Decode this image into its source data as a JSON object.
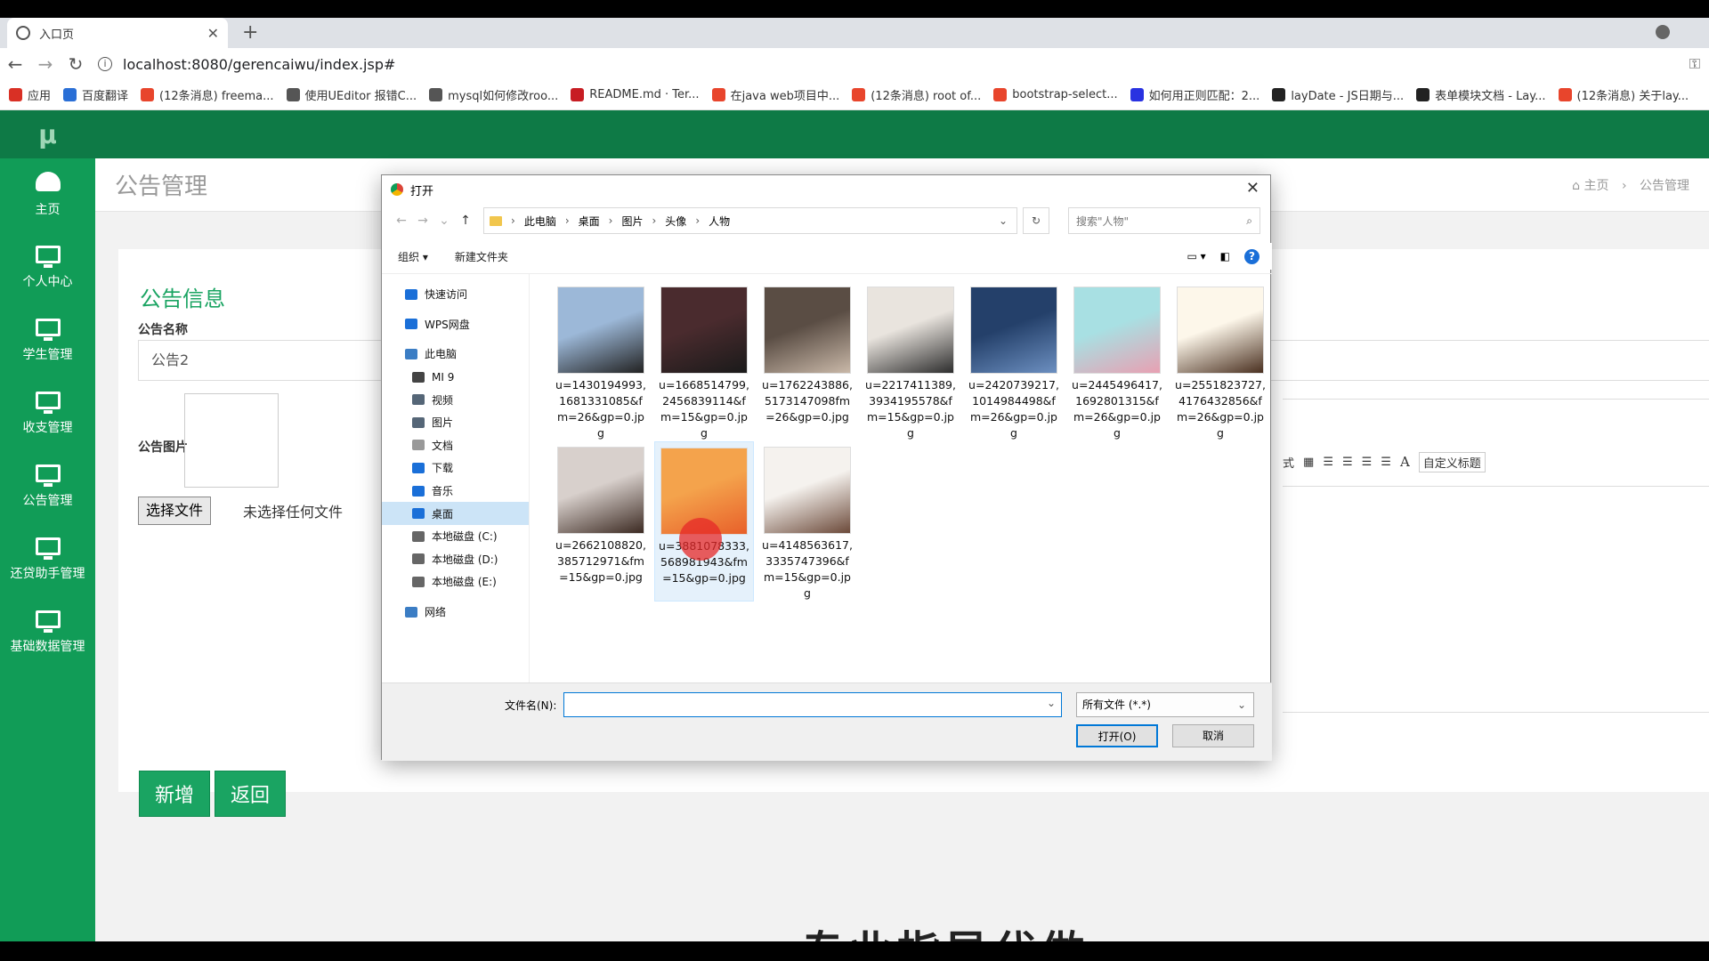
{
  "browser": {
    "tab_title": "入口页",
    "url": "localhost:8080/gerencaiwu/index.jsp#",
    "bookmarks": [
      {
        "label": "应用",
        "color": "#d93025"
      },
      {
        "label": "百度翻译",
        "color": "#2a6fd6"
      },
      {
        "label": "(12条消息) freema...",
        "color": "#e8452c"
      },
      {
        "label": "使用UEditor 报错C...",
        "color": "#555555"
      },
      {
        "label": "mysql如何修改roo...",
        "color": "#555555"
      },
      {
        "label": "README.md · Ter...",
        "color": "#c71d23"
      },
      {
        "label": "在java web项目中...",
        "color": "#e8452c"
      },
      {
        "label": "(12条消息) root of...",
        "color": "#e8452c"
      },
      {
        "label": "bootstrap-select...",
        "color": "#e8452c"
      },
      {
        "label": "如何用正则匹配：2...",
        "color": "#2932e1"
      },
      {
        "label": "layDate - JS日期与...",
        "color": "#222222"
      },
      {
        "label": "表单模块文档 - Lay...",
        "color": "#222222"
      },
      {
        "label": "(12条消息) 关于lay...",
        "color": "#e8452c"
      }
    ]
  },
  "sidebar": {
    "logo": "μ",
    "items": [
      {
        "label": "主页"
      },
      {
        "label": "个人中心"
      },
      {
        "label": "学生管理"
      },
      {
        "label": "收支管理"
      },
      {
        "label": "公告管理"
      },
      {
        "label": "还贷助手管理"
      },
      {
        "label": "基础数据管理"
      }
    ]
  },
  "page": {
    "title": "公告管理",
    "breadcrumb_home": "主页",
    "breadcrumb_current": "公告管理",
    "panel_title": "公告信息",
    "name_label": "公告名称",
    "name_value": "公告2",
    "image_label": "公告图片",
    "file_button": "选择文件",
    "file_status": "未选择任何文件",
    "editor_tools": [
      "式",
      "A",
      "自定义标题"
    ],
    "add_button": "新增",
    "back_button": "返回"
  },
  "dialog": {
    "title": "打开",
    "path": [
      "此电脑",
      "桌面",
      "图片",
      "头像",
      "人物"
    ],
    "search_placeholder": "搜索\"人物\"",
    "organize": "组织 ▾",
    "new_folder": "新建文件夹",
    "help": "?",
    "nav": [
      {
        "label": "快速访问",
        "color": "#1a6fd8"
      },
      {
        "label": "WPS网盘",
        "color": "#1a6fd8"
      },
      {
        "label": "此电脑",
        "color": "#3b7dc4"
      },
      {
        "label": "MI 9",
        "color": "#444444"
      },
      {
        "label": "视频",
        "color": "#556677"
      },
      {
        "label": "图片",
        "color": "#556677"
      },
      {
        "label": "文档",
        "color": "#999999"
      },
      {
        "label": "下载",
        "color": "#1a6fd8"
      },
      {
        "label": "音乐",
        "color": "#1a6fd8"
      },
      {
        "label": "桌面",
        "color": "#1a6fd8"
      },
      {
        "label": "本地磁盘 (C:)",
        "color": "#666666"
      },
      {
        "label": "本地磁盘 (D:)",
        "color": "#666666"
      },
      {
        "label": "本地磁盘 (E:)",
        "color": "#666666"
      },
      {
        "label": "网络",
        "color": "#3b7dc4"
      }
    ],
    "files": [
      {
        "l1": "u=1430194993,",
        "l2": "1681331085&f",
        "l3": "m=26&gp=0.jp",
        "l4": "g",
        "c1": "#9cb8d8",
        "c2": "#222222"
      },
      {
        "l1": "u=1668514799,",
        "l2": "2456839114&f",
        "l3": "m=15&gp=0.jp",
        "l4": "g",
        "c1": "#4a2b2e",
        "c2": "#1a1a1a"
      },
      {
        "l1": "u=1762243886,",
        "l2": "5173147098fm",
        "l3": "=26&gp=0.jpg",
        "l4": "",
        "c1": "#5a4d44",
        "c2": "#c9b8a8"
      },
      {
        "l1": "u=2217411389,",
        "l2": "3934195578&f",
        "l3": "m=15&gp=0.jp",
        "l4": "g",
        "c1": "#e9e4de",
        "c2": "#2d2d2d"
      },
      {
        "l1": "u=2420739217,",
        "l2": "1014984498&f",
        "l3": "m=26&gp=0.jp",
        "l4": "g",
        "c1": "#24406a",
        "c2": "#6c8fc0"
      },
      {
        "l1": "u=2445496417,",
        "l2": "1692801315&f",
        "l3": "m=26&gp=0.jp",
        "l4": "g",
        "c1": "#a8e0e3",
        "c2": "#e8a0b2"
      },
      {
        "l1": "u=2551823727,",
        "l2": "4176432856&f",
        "l3": "m=26&gp=0.jp",
        "l4": "g",
        "c1": "#fdf7ea",
        "c2": "#4a3020"
      },
      {
        "l1": "u=2662108820,",
        "l2": "385712971&fm",
        "l3": "=15&gp=0.jpg",
        "l4": "",
        "c1": "#d8d0cc",
        "c2": "#3c2a22"
      },
      {
        "l1": "u=3881078333,",
        "l2": "568981943&fm",
        "l3": "=15&gp=0.jpg",
        "l4": "",
        "c1": "#f4a34c",
        "c2": "#e8602a"
      },
      {
        "l1": "u=4148563617,",
        "l2": "3335747396&f",
        "l3": "m=15&gp=0.jp",
        "l4": "g",
        "c1": "#f5f2ee",
        "c2": "#6c4a3a"
      }
    ],
    "filename_label": "文件名(N):",
    "filename_value": "",
    "filetype": "所有文件 (*.*)",
    "open_button": "打开(O)",
    "cancel_button": "取消"
  },
  "caption": "专业指导代做"
}
